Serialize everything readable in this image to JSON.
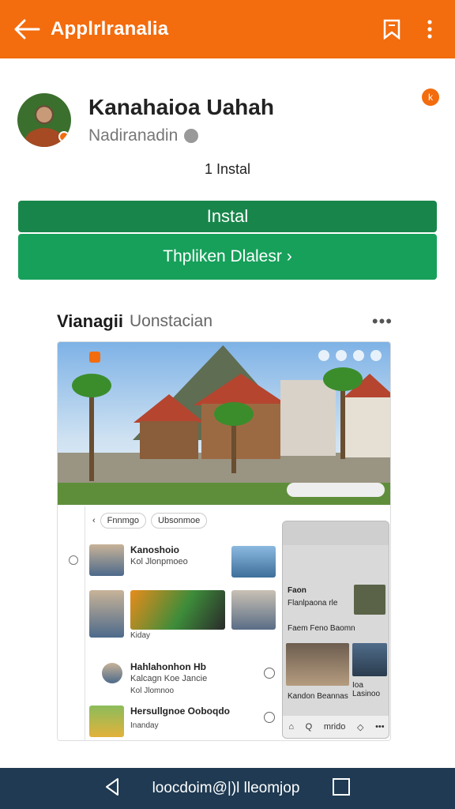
{
  "appbar": {
    "title": "Applrlranalia",
    "back_icon": "arrow-left-icon",
    "bookmark_icon": "bookmark-icon",
    "more_icon": "more-vert-icon",
    "color": "#f36c0e"
  },
  "profile": {
    "name": "Kanahaioa Uahah",
    "subtitle": "Nadiranadin",
    "badge": "k"
  },
  "installs": "1 Instal",
  "buttons": {
    "install": "Instal",
    "secondary": "Thpliken Dlalesr ›",
    "install_color": "#18864a",
    "secondary_color": "#16a05a"
  },
  "section": {
    "title": "Vianagii",
    "subtitle": "Uonstacian",
    "more": "•••"
  },
  "screenshot": {
    "feed_tabs": [
      "Fnnmgo",
      "Ubsonmoe"
    ],
    "feed_back": "‹",
    "rows": [
      {
        "title": "Kanoshoio",
        "subtitle": "Kol  Jlonpmoeo",
        "tag": ""
      },
      {
        "title": "",
        "subtitle": "",
        "tag": "Kiday"
      },
      {
        "title": "Hahlahonhon Hb",
        "subtitle": "Kalcagn  Koe Jancie",
        "tag": "Kol  Jlomnoo"
      },
      {
        "title": "Hersullgnoe Ooboqdo",
        "subtitle": "",
        "tag": "Inanday"
      }
    ],
    "phone": {
      "heading": "Faon",
      "line1": "Flanlpaona rle",
      "line2": "Faem Feno Baomn",
      "line3": "Kandon Beannas",
      "line4": "Ioa Lasinoo",
      "nav": [
        "⌂",
        "Q",
        "mrido",
        "◇",
        "•••"
      ]
    }
  },
  "sysnav": {
    "back_icon": "triangle-back-icon",
    "label": "loocdoim@|)l lleomjop",
    "recent_icon": "square-recents-icon"
  }
}
